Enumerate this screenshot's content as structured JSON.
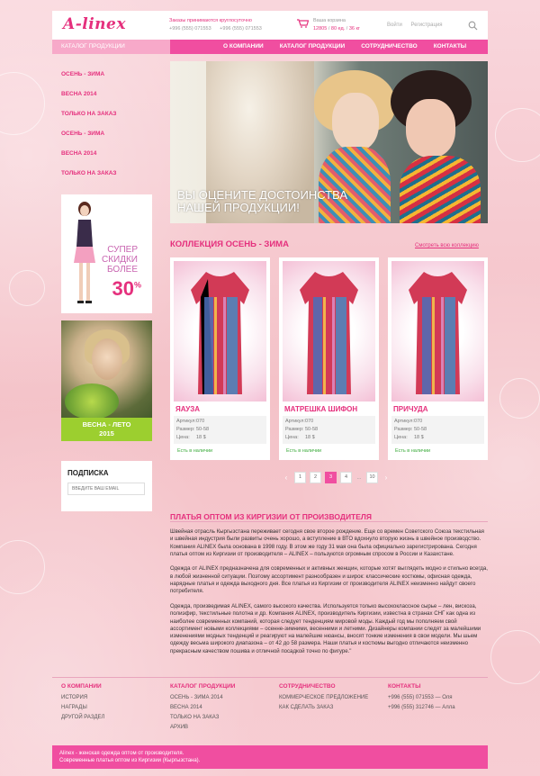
{
  "header": {
    "logo": "A-linex",
    "orders_title": "Заказы принимаются круглосуточно",
    "phones": [
      "+996 (555) 071553",
      "+996 (555) 071553"
    ],
    "cart_label": "Ваша корзина",
    "cart_sum": "12805",
    "cart_sep1": "/",
    "cart_qty": "80 ед.",
    "cart_sep2": "/",
    "cart_weight": "36 кг",
    "login": "Войти",
    "register": "Регистрация"
  },
  "nav": {
    "catalog": "КАТАЛОГ ПРОДУКЦИИ",
    "items": [
      "О КОМПАНИИ",
      "КАТАЛОГ ПРОДУКЦИИ",
      "СОТРУДНИЧЕСТВО",
      "КОНТАКТЫ"
    ]
  },
  "sidebar": {
    "items": [
      "ОСЕНЬ - ЗИМА",
      "ВЕСНА 2014",
      "ТОЛЬКО НА ЗАКАЗ",
      "ОСЕНЬ - ЗИМА",
      "ВЕСНА 2014",
      "ТОЛЬКО НА ЗАКАЗ"
    ],
    "promo1_l1": "СУПЕР",
    "promo1_l2": "СКИДКИ",
    "promo1_l3": "БОЛЕЕ",
    "promo1_pct": "30",
    "promo1_sign": "%",
    "promo2_l1": "ВЕСНА - ЛЕТО",
    "promo2_l2": "2015",
    "subscribe_title": "ПОДПИСКА",
    "subscribe_placeholder": "ВВЕДИТЕ ВАШ EMAIL"
  },
  "banner": {
    "line1": "ВЫ ОЦЕНИТЕ ДОСТОИНСТВА",
    "line2": "НАШЕЙ ПРОДУКЦИИ!"
  },
  "collection": {
    "title": "КОЛЛЕКЦИЯ ОСЕНЬ - ЗИМА",
    "link": "Смотреть всю коллекцию",
    "spec_labels": [
      "Артикул:",
      "Размер:",
      "Цена:"
    ],
    "products": [
      {
        "name": "ЯАУЗА",
        "article": "070",
        "size": "50-58",
        "price": "18 $",
        "status": "Есть  в наличии"
      },
      {
        "name": "МАТРЕШКА ШИФОН",
        "article": "070",
        "size": "50-58",
        "price": "18 $",
        "status": "Есть  в наличии"
      },
      {
        "name": "ПРИЧУДА",
        "article": "070",
        "size": "50-58",
        "price": "18 $",
        "status": "Есть  в наличии"
      }
    ]
  },
  "pagination": {
    "pages": [
      "1",
      "2",
      "3",
      "4"
    ],
    "dots": "...",
    "last": "10",
    "current": "3"
  },
  "about": {
    "title": "ПЛАТЬЯ ОПТОМ ИЗ КИРГИЗИИ ОТ ПРОИЗВОДИТЕЛЯ",
    "p1": "Швейная отрасль Кыргызстана переживает сегодня свое второе рождение. Еще со времен Советского Союза текстильная и швейная индустрия были развиты очень хорошо, а вступление в ВТО вдохнуло вторую жизнь в швейное производство. Компания ALINEX была основана в 1998 году. В этом же году 31 мая она была официально зарегистрирована. Сегодня платья оптом из Киргизии от производителя – ALINEX – пользуются огромным спросом в России и Казахстане.",
    "p2": "Одежда от ALINEX предназначена для современных и активных женщин, которые хотят выглядеть модно и стильно всегда, в любой жизненной ситуации. Поэтому ассортимент разнообразен и широк: классические костюмы, офисная одежда, нарядные платья и одежда выходного дня. Все платья из Киргизии от производителя ALINEX неизменно найдут своего потребителя.",
    "p3": "Одежда, произведимая ALINEX, самого высокого качества. Используется только высококлассное сырье – лен, вискоза, полиэфир, текстильные полотна и др. Компания ALINEX, производитель Киргизии, известна в странах СНГ как одна из наиболее современных компаний, которая следует тенденциям мировой моды. Каждый год мы пополняем свой ассортимент новыми коллекциями – осенне-зимними, весенними и летними. Дизайнеры компании следят за малейшими изменениями модных тенденций и реагируют на малейшие нюансы, вносят тонкие изменения в свои модели. Мы шьем одежду весьма широкого диапазона – от 42 до 58 размера. Наши платья и костюмы выгодно отличаются неизменно прекрасным качеством пошива и отличной посадкой точно по фигуре.\""
  },
  "footer": {
    "col1": {
      "title": "О КОМПАНИИ",
      "items": [
        "ИСТОРИЯ",
        "НАГРАДЫ",
        "ДРУГОЙ РАЗДЕЛ"
      ]
    },
    "col2": {
      "title": "КАТАЛОГ ПРОДУКЦИИ",
      "items": [
        "ОСЕНЬ - ЗИМА 2014",
        "ВЕСНА 2014",
        "ТОЛЬКО НА ЗАКАЗ",
        "АРХИВ"
      ]
    },
    "col3": {
      "title": "СОТРУДНИЧЕСТВО",
      "items": [
        "КОММЕРЧЕСКОЕ ПРЕДЛОЖЕНИЕ",
        "КАК СДЕЛАТЬ ЗАКАЗ"
      ]
    },
    "col4": {
      "title": "КОНТАКТЫ",
      "items": [
        "+996 (555) 071553 — Оля",
        "+996 (555) 312746 — Алла"
      ]
    },
    "bar1": "Alinex - женская одежда оптом от производителя.",
    "bar2": "Современные платья оптом из Киргизии (Кыргызстана)."
  },
  "colors": {
    "accent": "#f04ea0",
    "brand": "#e5307d",
    "ok": "#3cab3c"
  },
  "icons": {
    "cart": "cart-icon",
    "search": "search-icon"
  }
}
